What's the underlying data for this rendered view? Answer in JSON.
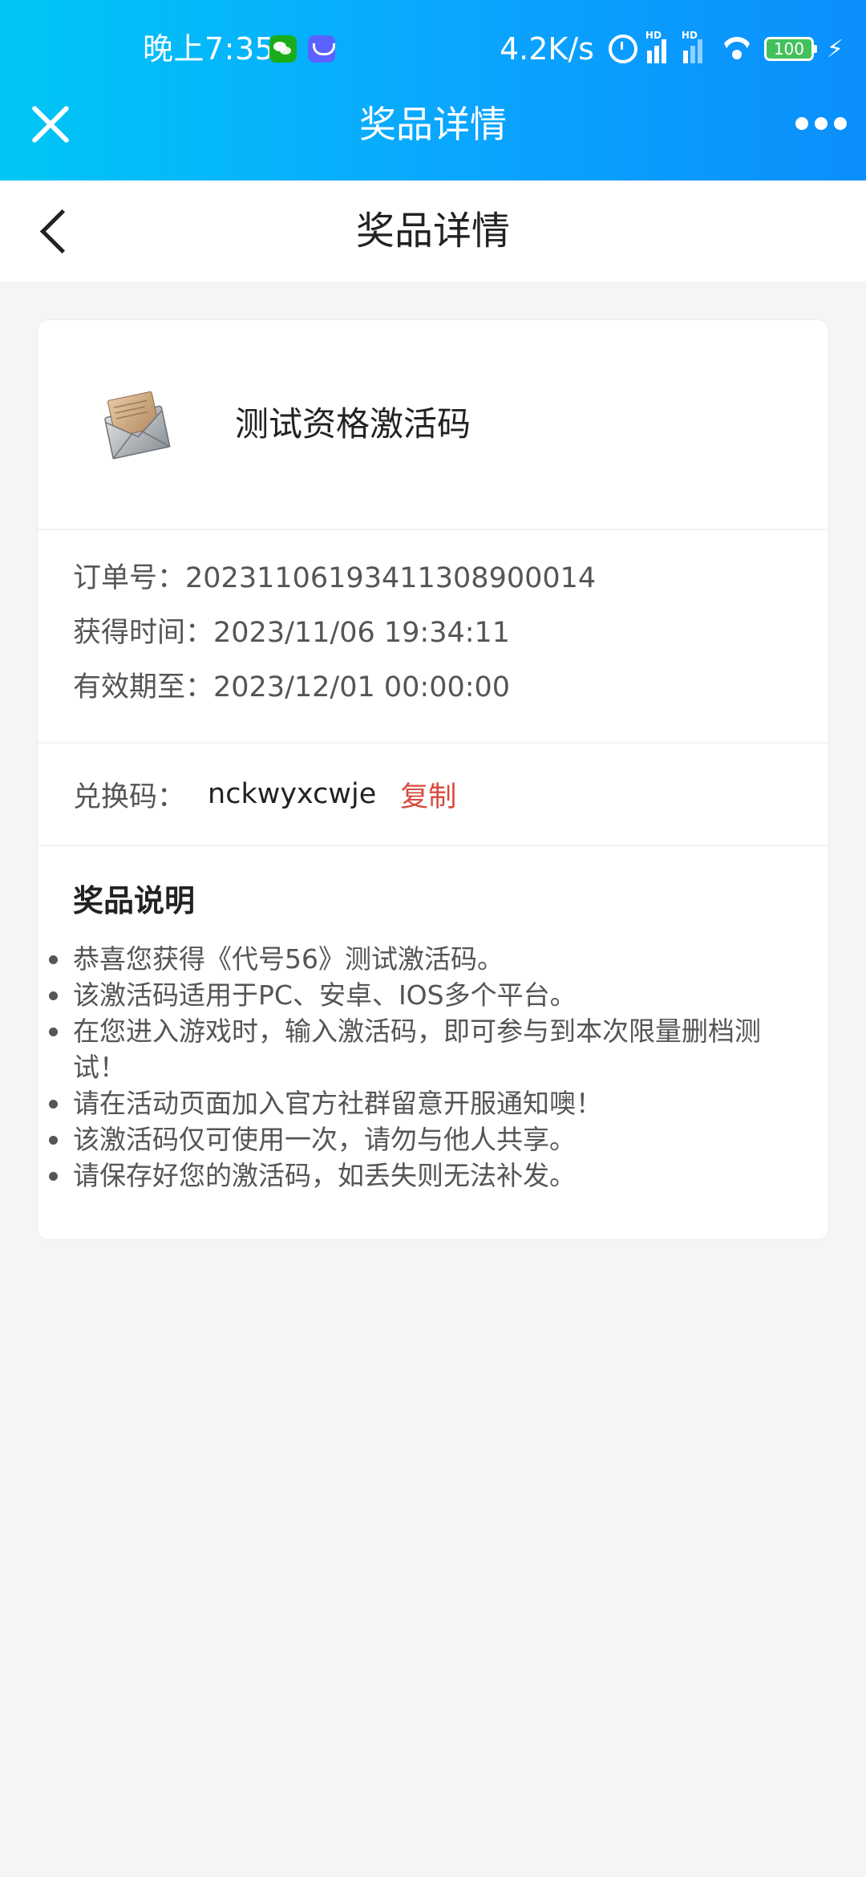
{
  "status_bar": {
    "time": "晚上7:35",
    "net_speed": "4.2K/s",
    "battery": "100",
    "icons": [
      "wechat-icon",
      "lark-icon",
      "alarm-icon",
      "signal-icon",
      "wifi-icon",
      "battery-icon",
      "charging-icon"
    ]
  },
  "webview_bar": {
    "title": "奖品详情",
    "left_icon": "close-icon",
    "right_icon": "more-icon"
  },
  "nav": {
    "title": "奖品详情",
    "back_icon": "back-icon"
  },
  "prize": {
    "name": "测试资格激活码",
    "icon": "envelope-icon"
  },
  "order": {
    "order_label": "订单号：",
    "order_no": "20231106193411308900014",
    "obtain_label": "获得时间：",
    "obtain_time": "2023/11/06 19:34:11",
    "expire_label": "有效期至：",
    "expire_time": "2023/12/01 00:00:00"
  },
  "redeem": {
    "label": "兑换码：",
    "code": "nckwyxcwje",
    "copy_label": "复制",
    "copy_color": "#d8493f"
  },
  "description": {
    "title": "奖品说明",
    "items": [
      "恭喜您获得《代号56》测试激活码。",
      "该激活码适用于PC、安卓、IOS多个平台。",
      "在您进入游戏时，输入激活码，即可参与到本次限量删档测试！",
      "请在活动页面加入官方社群留意开服通知噢！",
      "该激活码仅可使用一次，请勿与他人共享。",
      "请保存好您的激活码，如丢失则无法补发。"
    ]
  },
  "colors": {
    "header_gradient_start": "#00c6f5",
    "header_gradient_end": "#0b8ffb",
    "page_background": "#f5f5f5",
    "accent_red": "#d8493f"
  }
}
